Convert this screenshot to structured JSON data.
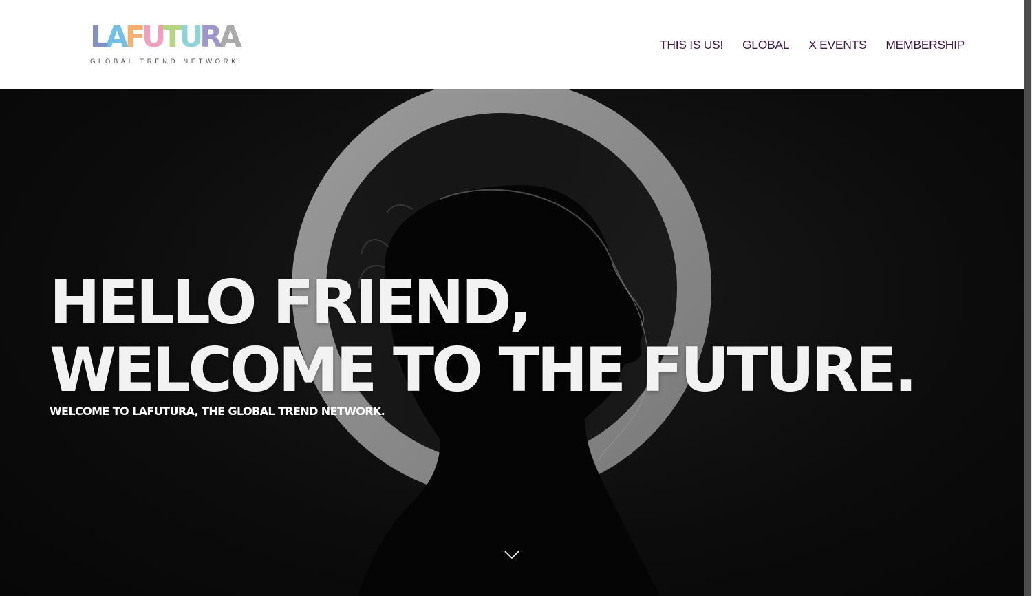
{
  "header": {
    "logo": {
      "letters": [
        "L",
        "A",
        "F",
        "U",
        "T",
        "U",
        "R",
        "A"
      ],
      "letter_colors": [
        "#6f7cb8",
        "#5bb6e3",
        "#f2a35a",
        "#ef8fb4",
        "#a9cf6b",
        "#7fcbd3",
        "#8c86c2",
        "#9c9c9c"
      ],
      "tagline": "GLOBAL TREND NETWORK"
    },
    "nav": [
      {
        "label": "THIS IS US!"
      },
      {
        "label": "GLOBAL"
      },
      {
        "label": "X EVENTS"
      },
      {
        "label": "MEMBERSHIP"
      }
    ]
  },
  "hero": {
    "title_line1": "HELLO FRIEND,",
    "title_line2": "WELCOME TO THE FUTURE.",
    "subtitle": "WELCOME TO LAFUTURA, THE GLOBAL TREND NETWORK.",
    "scroll_icon": "chevron-down-icon"
  },
  "colors": {
    "nav_text": "#3e1a47",
    "hero_text": "#f2f2f2",
    "hero_bg": "#0d0d0d",
    "ring": "#8a8a8a"
  }
}
